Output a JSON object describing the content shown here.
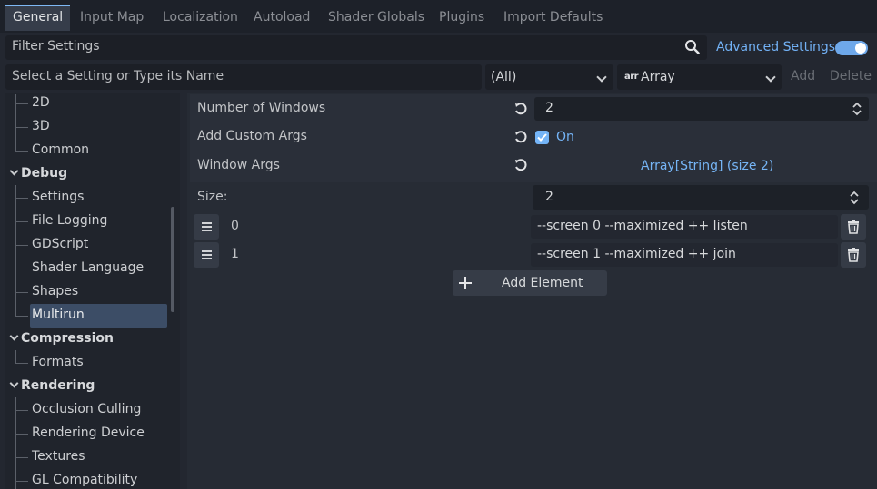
{
  "tabs": [
    {
      "label": "General",
      "active": true
    },
    {
      "label": "Input Map"
    },
    {
      "label": "Localization"
    },
    {
      "label": "Autoload"
    },
    {
      "label": "Shader Globals"
    },
    {
      "label": "Plugins"
    },
    {
      "label": "Import Defaults"
    }
  ],
  "filter": {
    "placeholder": "Filter Settings",
    "advanced_label": "Advanced Settings",
    "advanced_on": true
  },
  "add_row": {
    "name_placeholder": "Select a Setting or Type its Name",
    "scope_value": "(All)",
    "type_icon": "arr",
    "type_value": "Array",
    "add_label": "Add",
    "delete_label": "Delete"
  },
  "tree": {
    "items": [
      {
        "label": "2D",
        "kind": "item"
      },
      {
        "label": "3D",
        "kind": "item"
      },
      {
        "label": "Common",
        "kind": "item"
      },
      {
        "label": "Debug",
        "kind": "category"
      },
      {
        "label": "Settings",
        "kind": "item"
      },
      {
        "label": "File Logging",
        "kind": "item"
      },
      {
        "label": "GDScript",
        "kind": "item"
      },
      {
        "label": "Shader Language",
        "kind": "item"
      },
      {
        "label": "Shapes",
        "kind": "item"
      },
      {
        "label": "Multirun",
        "kind": "item",
        "selected": true
      },
      {
        "label": "Compression",
        "kind": "category"
      },
      {
        "label": "Formats",
        "kind": "item"
      },
      {
        "label": "Rendering",
        "kind": "category"
      },
      {
        "label": "Occlusion Culling",
        "kind": "item"
      },
      {
        "label": "Rendering Device",
        "kind": "item"
      },
      {
        "label": "Textures",
        "kind": "item"
      },
      {
        "label": "GL Compatibility",
        "kind": "item"
      }
    ]
  },
  "inspector": {
    "number_of_windows": {
      "label": "Number of Windows",
      "value": "2"
    },
    "add_custom_args": {
      "label": "Add Custom Args",
      "checked": true,
      "state_label": "On"
    },
    "window_args": {
      "label": "Window Args",
      "summary": "Array[String] (size 2)"
    },
    "size": {
      "label": "Size:",
      "value": "2"
    },
    "elements": [
      {
        "index": "0",
        "value": "--screen 0 --maximized ++ listen"
      },
      {
        "index": "1",
        "value": "--screen 1 --maximized ++ join"
      }
    ],
    "add_element_label": "Add Element"
  },
  "colors": {
    "accent": "#74b4f7",
    "selected": "#3c4d66"
  }
}
